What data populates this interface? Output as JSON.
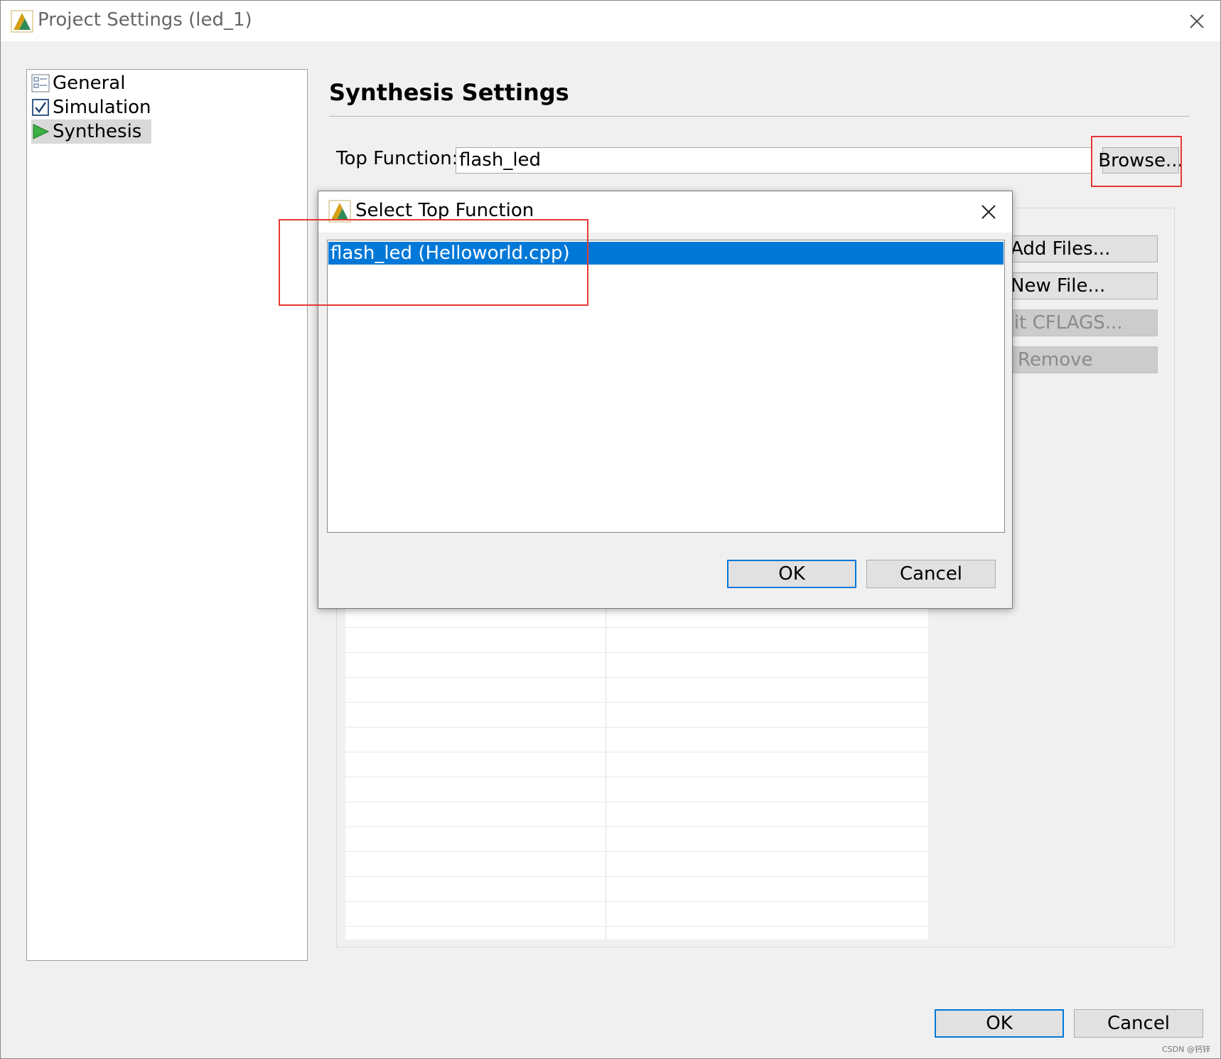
{
  "window": {
    "title": "Project Settings (led_1)"
  },
  "nav": {
    "items": [
      {
        "label": "General",
        "icon": "general-icon"
      },
      {
        "label": "Simulation",
        "icon": "checkbox-icon"
      },
      {
        "label": "Synthesis",
        "icon": "play-arrow-icon"
      }
    ],
    "selected": "Synthesis"
  },
  "main": {
    "heading": "Synthesis Settings",
    "top_function_label": "Top Function:",
    "top_function_value": "flash_led",
    "browse_label": "Browse...",
    "side_buttons": {
      "add_files": "Add Files...",
      "new_file": "New File...",
      "edit_cflags": "Edit CFLAGS...",
      "remove": "Remove"
    }
  },
  "dialog": {
    "title": "Select Top Function",
    "items": [
      "flash_led (Helloworld.cpp)"
    ],
    "ok_label": "OK",
    "cancel_label": "Cancel"
  },
  "footer": {
    "ok_label": "OK",
    "cancel_label": "Cancel"
  },
  "watermark": "CSDN @钙锌",
  "colors": {
    "selection": "#0078d7",
    "highlight": "#e53935",
    "primary_border": "#0078d7"
  }
}
